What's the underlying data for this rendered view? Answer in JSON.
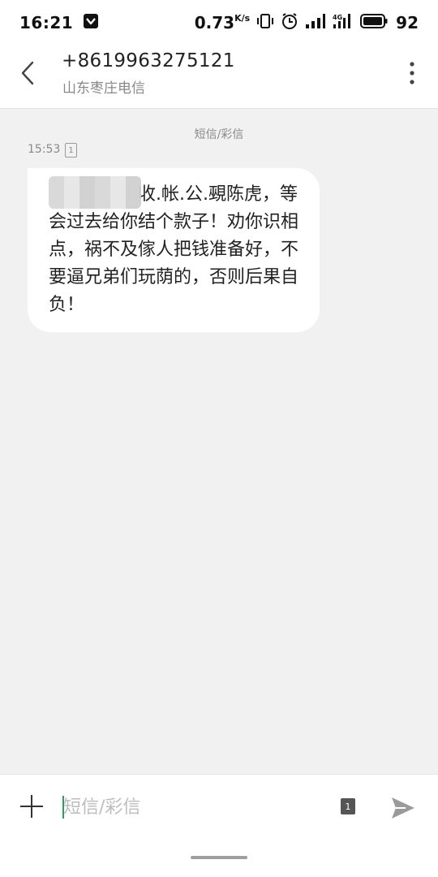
{
  "status_bar": {
    "time": "16:21",
    "net_speed": "0.73",
    "net_speed_unit": "K/s",
    "battery_level": "92",
    "signal_label": "4G"
  },
  "header": {
    "contact_number": "+8619963275121",
    "carrier": "山东枣庄电信"
  },
  "conversation": {
    "message_type_label": "短信/彩信",
    "message_time": "15:53",
    "sim_badge": "1",
    "message_text": "　　　　　收.帐.公.覡陈虎，等会过去给你结个款子！劝你识相点，祸不及傢人把钱准备好，不要逼兄弟们玩荫的，否则后果自负！"
  },
  "composer": {
    "placeholder": "短信/彩信",
    "sim_select": "1"
  },
  "colors": {
    "background": "#f1f1f1",
    "bubble": "#ffffff",
    "caret": "#2e9e5e",
    "send_icon": "#9a9a9a"
  }
}
